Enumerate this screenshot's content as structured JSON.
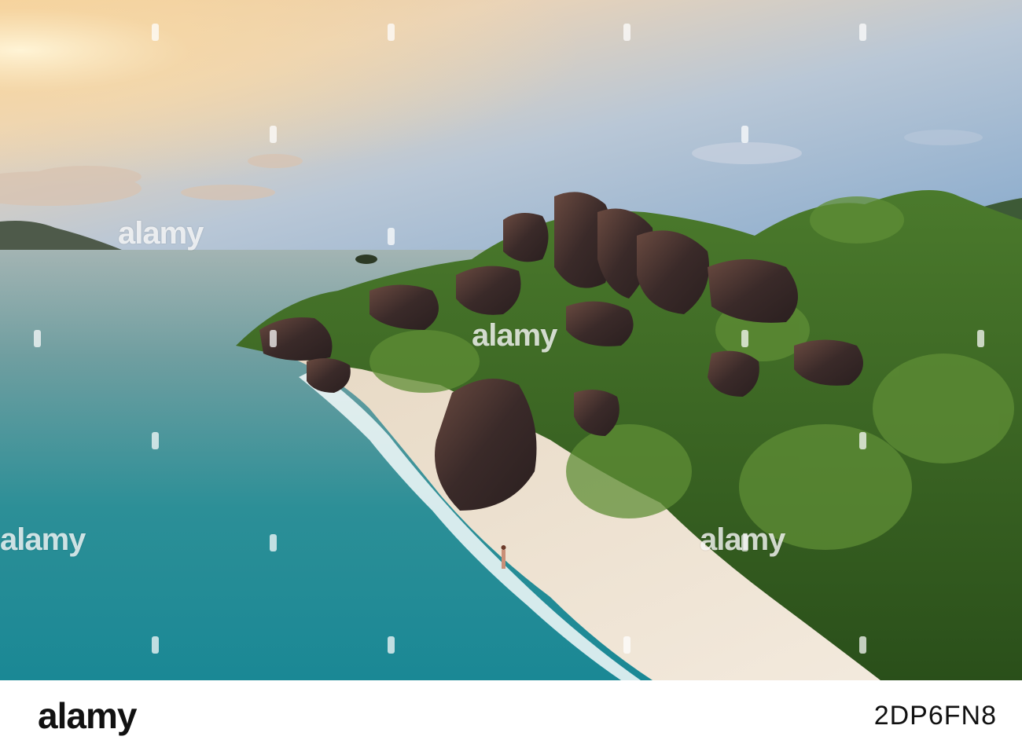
{
  "photo": {
    "scene": "aerial-beach-sunset",
    "colors": {
      "sky_top": "#8fb3d4",
      "sky_glow": "#f6c98a",
      "sea_far": "#7fa3a8",
      "sea_near": "#1f8f98",
      "sand": "#efe4d3",
      "rock": "#3b2c2c",
      "jungle": "#2f5a1e"
    }
  },
  "watermark": {
    "word": "alamy"
  },
  "footer": {
    "logo": "alamy",
    "image_id": "2DP6FN8"
  }
}
